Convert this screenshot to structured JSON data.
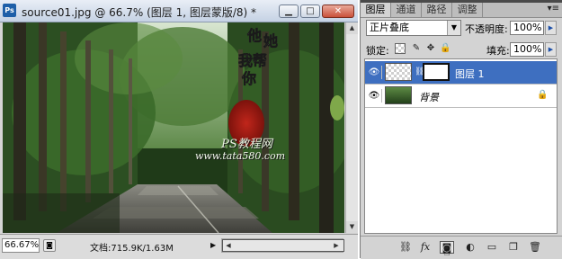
{
  "document": {
    "title": "source01.jpg @ 66.7% (图层 1, 图层蒙版/8) *",
    "zoom": "66.67%",
    "info": "文档:715.9K/1.63M",
    "watermark": {
      "site_name": "PS教程网",
      "site_url": "www.tata580.com"
    }
  },
  "panel": {
    "tabs": [
      "图层",
      "通道",
      "路径",
      "调整"
    ],
    "active_tab": "图层",
    "blend_mode": "正片叠底",
    "opacity_label": "不透明度:",
    "opacity_value": "100%",
    "lock_label": "锁定:",
    "fill_label": "填充:",
    "fill_value": "100%",
    "layers": [
      {
        "name": "图层 1",
        "selected": true,
        "has_mask": true
      },
      {
        "name": "背景",
        "selected": false,
        "locked": true
      }
    ]
  },
  "colors": {
    "selection": "#3e6fc0",
    "title_bar": "#c5d2e4",
    "panel_bg": "#d3d3d3"
  }
}
